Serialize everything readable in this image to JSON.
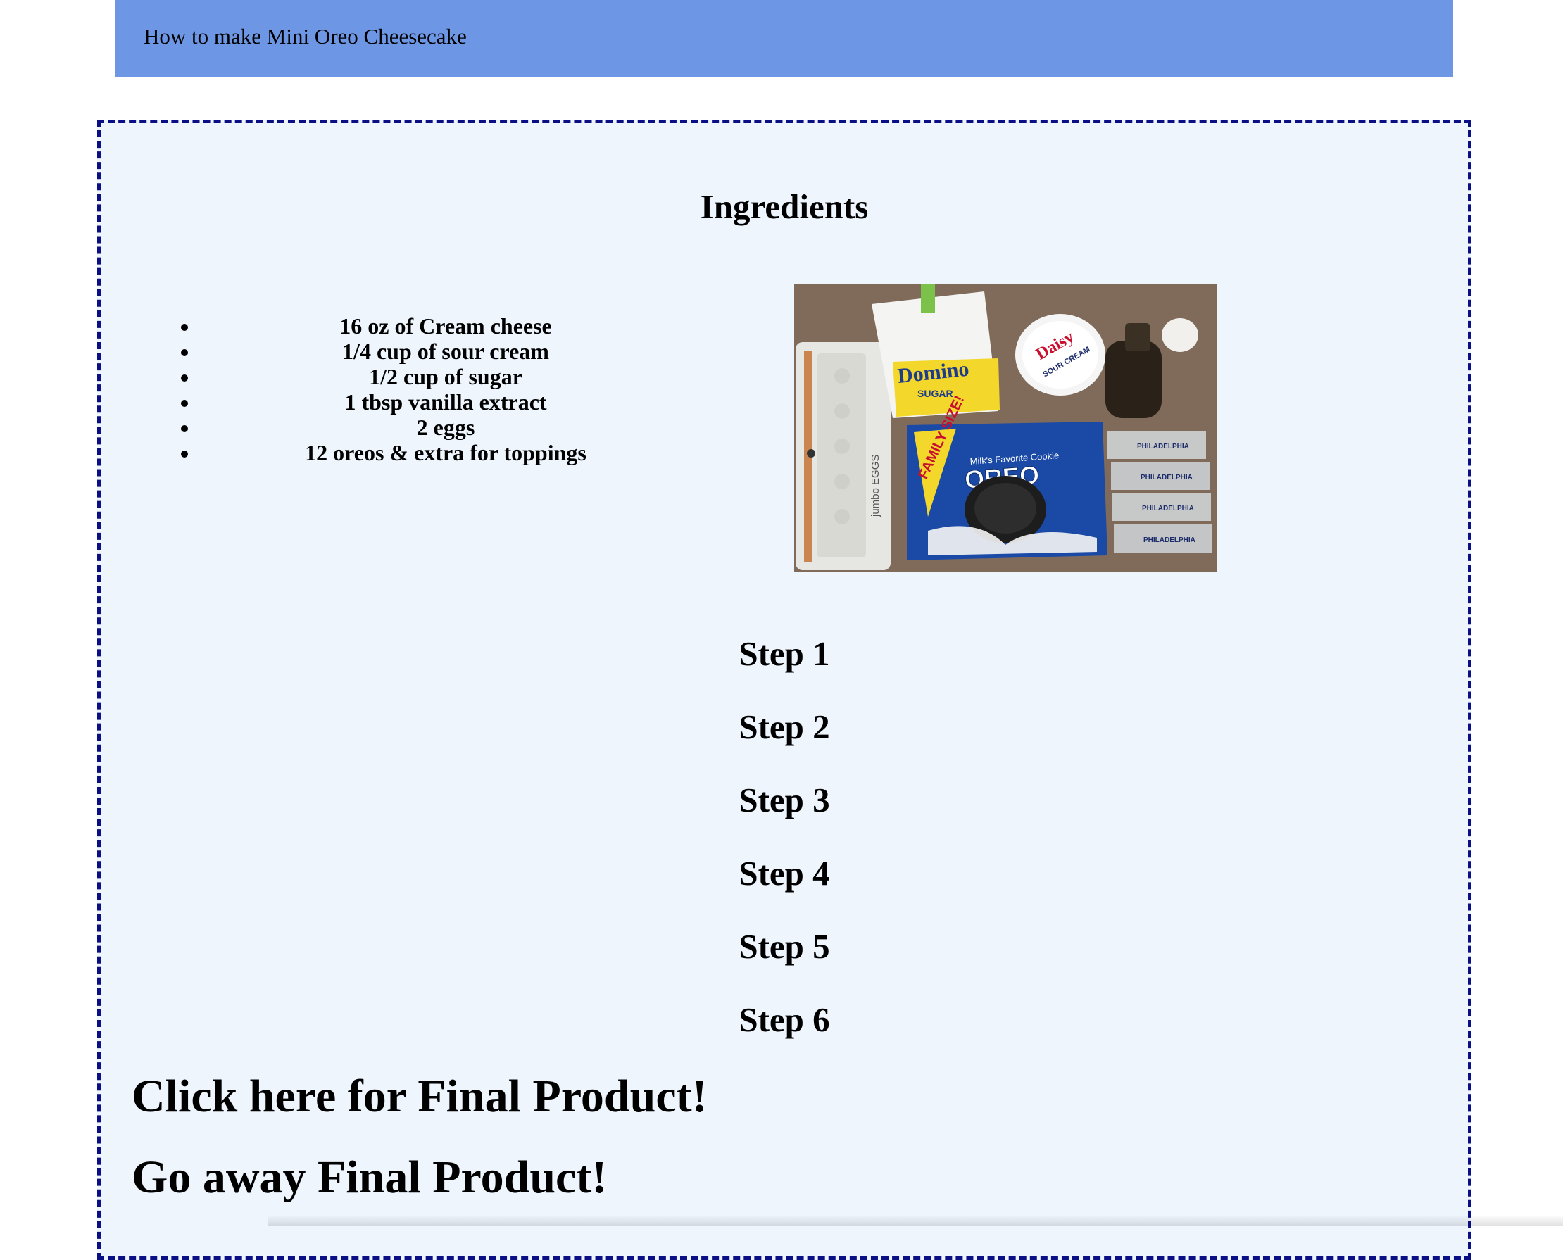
{
  "header": {
    "title": "How to make Mini Oreo Cheesecake",
    "background_color": "#6d97e5"
  },
  "ingredients": {
    "heading": "Ingredients",
    "items": [
      "16 oz of Cream cheese",
      "1/4 cup of sour cream",
      "1/2 cup of sugar",
      "1 tbsp vanilla extract",
      "2 eggs",
      "12 oreos & extra for toppings"
    ],
    "photo": {
      "sugar_brand": "Domino",
      "sugar_label": "SUGAR",
      "sour_cream_brand": "Daisy",
      "sour_cream_label": "SOUR CREAM",
      "eggs_label": "jumbo EGGS",
      "oreo_tagline": "Milk's Favorite Cookie",
      "oreo_brand": "OREO",
      "oreo_badge": "FAMILY SIZE!",
      "cream_cheese_brand": "PHILADELPHIA"
    }
  },
  "steps": [
    "Step 1",
    "Step 2",
    "Step 3",
    "Step 4",
    "Step 5",
    "Step 6"
  ],
  "links": {
    "show_final": "Click here for Final Product!",
    "hide_final": "Go away Final Product!"
  },
  "colors": {
    "container_border": "#0b0f86",
    "container_background": "#eef5fd"
  }
}
